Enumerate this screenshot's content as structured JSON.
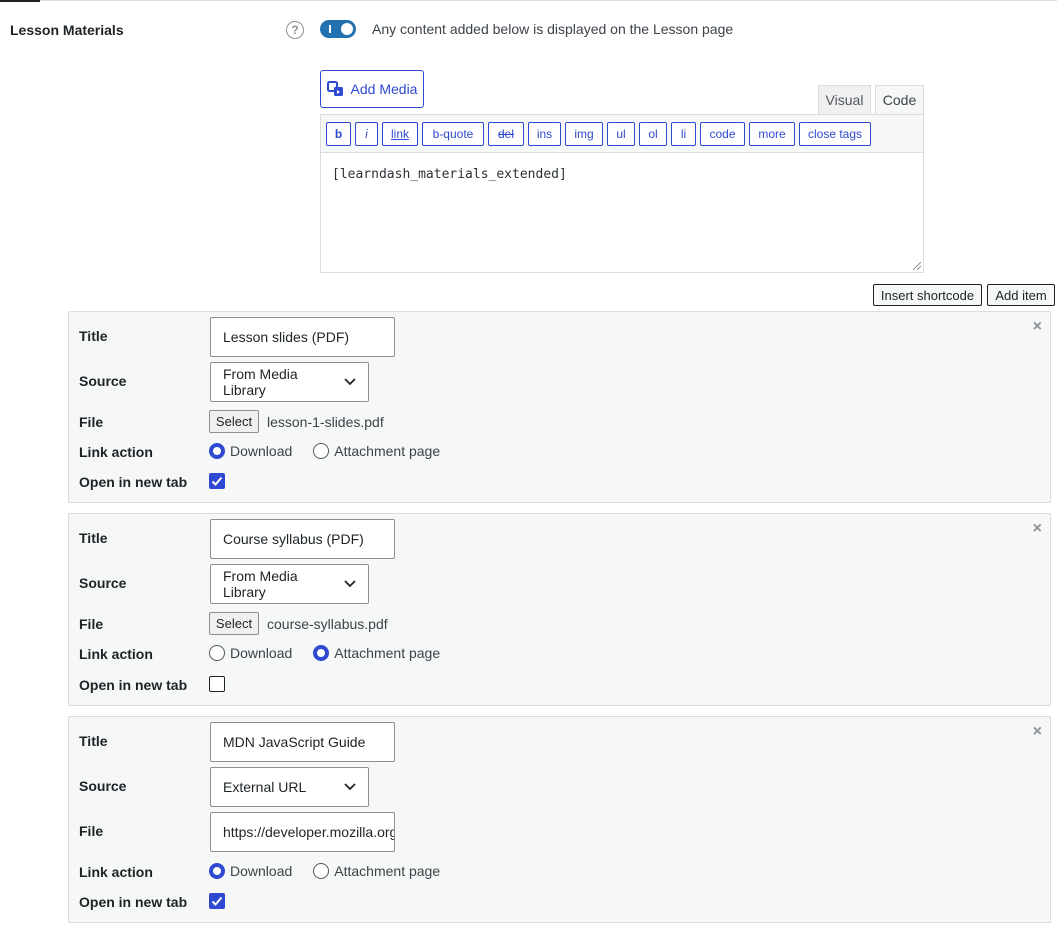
{
  "section": {
    "label": "Lesson Materials",
    "help": "?",
    "toggle_on": true,
    "toggle_description": "Any content added below is displayed on the Lesson page"
  },
  "editor": {
    "add_media_label": "Add Media",
    "tabs": [
      "Visual",
      "Code"
    ],
    "active_tab": "Code",
    "quicktags": [
      "b",
      "i",
      "link",
      "b-quote",
      "del",
      "ins",
      "img",
      "ul",
      "ol",
      "li",
      "code",
      "more",
      "close tags"
    ],
    "content": "[learndash_materials_extended]"
  },
  "actions": {
    "insert_shortcode": "Insert shortcode",
    "add_item": "Add item"
  },
  "labels": {
    "title": "Title",
    "source": "Source",
    "file": "File",
    "link_action": "Link action",
    "open_new_tab": "Open in new tab",
    "select": "Select",
    "download": "Download",
    "attachment_page": "Attachment page",
    "remove": "×"
  },
  "items": [
    {
      "title": "Lesson slides (PDF)",
      "source": "From Media Library",
      "file": "lesson-1-slides.pdf",
      "link_action": "Download",
      "open_new_tab": true
    },
    {
      "title": "Course syllabus (PDF)",
      "source": "From Media Library",
      "file": "course-syllabus.pdf",
      "link_action": "Attachment page",
      "open_new_tab": false
    },
    {
      "title": "MDN JavaScript Guide",
      "source": "External URL",
      "file": "https://developer.mozilla.org/",
      "link_action": "Download",
      "open_new_tab": true
    }
  ],
  "colors": {
    "accent": "#2f49d1",
    "toggle": "#2271b1",
    "panel": "#f6f7f7"
  }
}
